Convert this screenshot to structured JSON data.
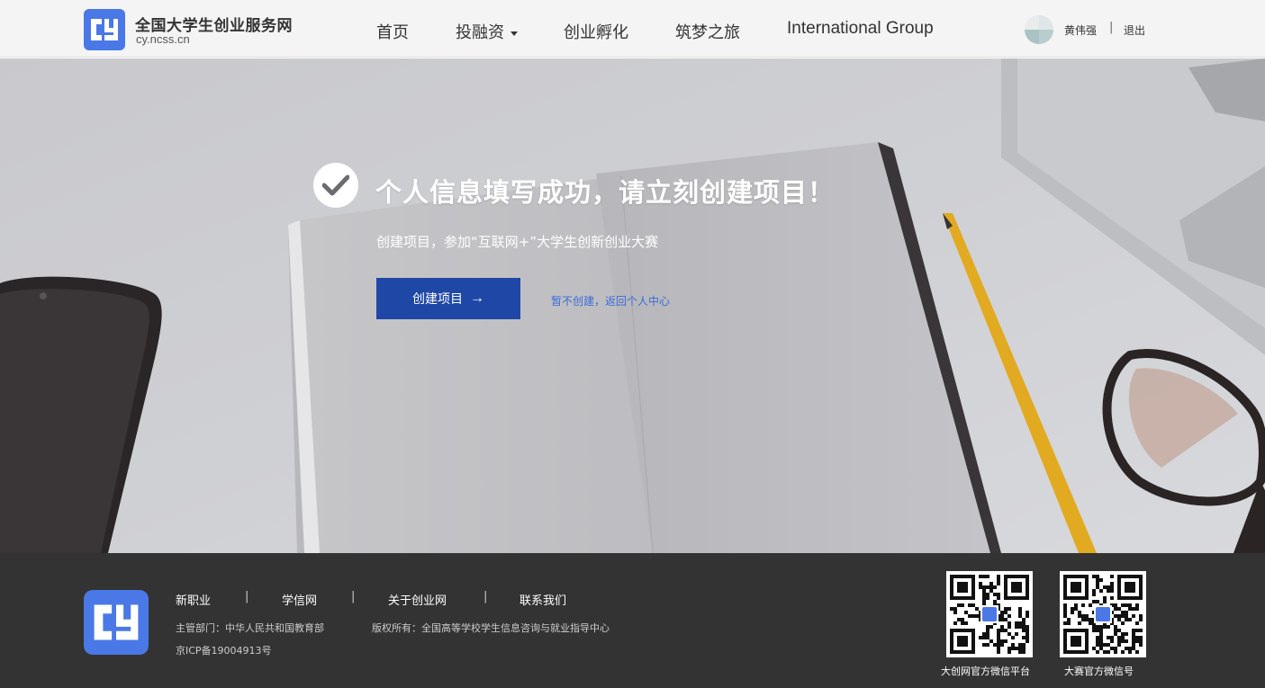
{
  "header": {
    "site_name": "全国大学生创业服务网",
    "site_domain": "cy.ncss.cn",
    "nav": [
      "首页",
      "投融资",
      "创业孵化",
      "筑梦之旅",
      "International Group"
    ],
    "username": "黄伟强",
    "separator": "|",
    "logout": "退出"
  },
  "hero": {
    "title": "个人信息填写成功，请立刻创建项目！",
    "subtitle": "创建项目，参加“互联网+”大学生创新创业大赛",
    "create_button": "创建项目",
    "create_arrow": "→",
    "return_link": "暂不创建，返回个人中心"
  },
  "footer": {
    "links": [
      "新职业",
      "学信网",
      "关于创业网",
      "联系我们"
    ],
    "separator": "|",
    "authority": "主管部门：中华人民共和国教育部",
    "copyright": "版权所有：全国高等学校学生信息咨询与就业指导中心",
    "icp": "京ICP备19004913号",
    "qr_labels": [
      "大创网官方微信平台",
      "大赛官方微信号"
    ]
  },
  "colors": {
    "brand_blue": "#4a78e6",
    "button_blue": "#1f48a6",
    "link_blue": "#3a6bd6",
    "footer_bg": "#333333"
  },
  "icons": [
    "cy-logo-icon",
    "check-circle-icon",
    "caret-down-icon",
    "arrow-right-icon",
    "qr-code-icon"
  ]
}
